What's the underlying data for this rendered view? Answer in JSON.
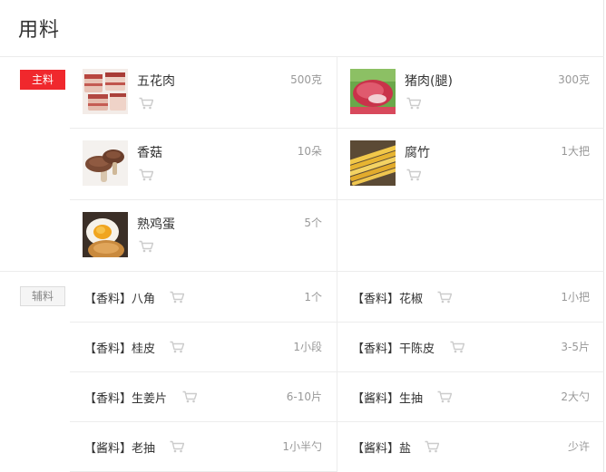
{
  "page_title": "用料",
  "colors": {
    "main_tag": "#f0282d",
    "cart_icon": "#cccccc",
    "divider": "#ececec"
  },
  "main": {
    "tag": "主料",
    "items": [
      {
        "name": "五花肉",
        "qty": "500克",
        "image": "pork-belly-photo"
      },
      {
        "name": "猪肉(腿)",
        "qty": "300克",
        "image": "pork-leg-photo"
      },
      {
        "name": "香菇",
        "qty": "10朵",
        "image": "shiitake-photo"
      },
      {
        "name": "腐竹",
        "qty": "1大把",
        "image": "tofu-skin-photo"
      },
      {
        "name": "熟鸡蛋",
        "qty": "5个",
        "image": "boiled-egg-photo"
      }
    ]
  },
  "aux": {
    "tag": "辅料",
    "items": [
      {
        "name": "【香料】八角",
        "qty": "1个"
      },
      {
        "name": "【香料】花椒",
        "qty": "1小把"
      },
      {
        "name": "【香料】桂皮",
        "qty": "1小段"
      },
      {
        "name": "【香料】干陈皮",
        "qty": "3-5片"
      },
      {
        "name": "【香料】生姜片",
        "qty": "6-10片"
      },
      {
        "name": "【酱料】生抽",
        "qty": "2大勺"
      },
      {
        "name": "【酱料】老抽",
        "qty": "1小半勺"
      },
      {
        "name": "【酱料】盐",
        "qty": "少许"
      }
    ]
  }
}
